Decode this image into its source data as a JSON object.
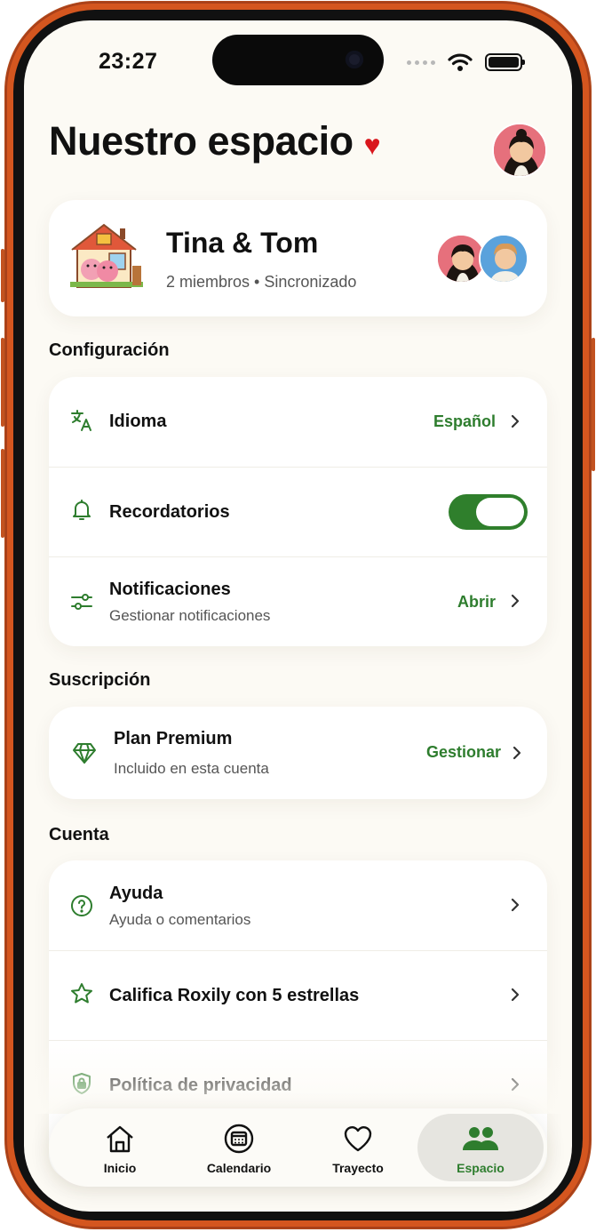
{
  "status_bar": {
    "time": "23:27"
  },
  "header": {
    "title": "Nuestro espacio",
    "title_emoji": "♥"
  },
  "couple": {
    "name": "Tina & Tom",
    "subtitle": "2 miembros • Sincronizado"
  },
  "sections": {
    "config": "Configuración",
    "subscription": "Suscripción",
    "account": "Cuenta"
  },
  "config": {
    "language": {
      "label": "Idioma",
      "value": "Español"
    },
    "reminders": {
      "label": "Recordatorios",
      "enabled": true
    },
    "notifications": {
      "label": "Notificaciones",
      "sub": "Gestionar notificaciones",
      "action": "Abrir"
    }
  },
  "subscription": {
    "label": "Plan Premium",
    "sub": "Incluido en esta cuenta",
    "action": "Gestionar"
  },
  "account": {
    "help": {
      "label": "Ayuda",
      "sub": "Ayuda o comentarios"
    },
    "rate": {
      "label": "Califica Roxily con 5 estrellas"
    },
    "privacy": {
      "label": "Política de privacidad"
    }
  },
  "tabbar": {
    "tabs": [
      {
        "label": "Inicio",
        "icon": "home-icon"
      },
      {
        "label": "Calendario",
        "icon": "calendar-icon"
      },
      {
        "label": "Trayecto",
        "icon": "heart-icon"
      },
      {
        "label": "Espacio",
        "icon": "people-icon"
      }
    ],
    "active": "Espacio"
  },
  "colors": {
    "accent": "#2e7d2e",
    "background": "#fcfaf4",
    "frame": "#d4561f"
  }
}
